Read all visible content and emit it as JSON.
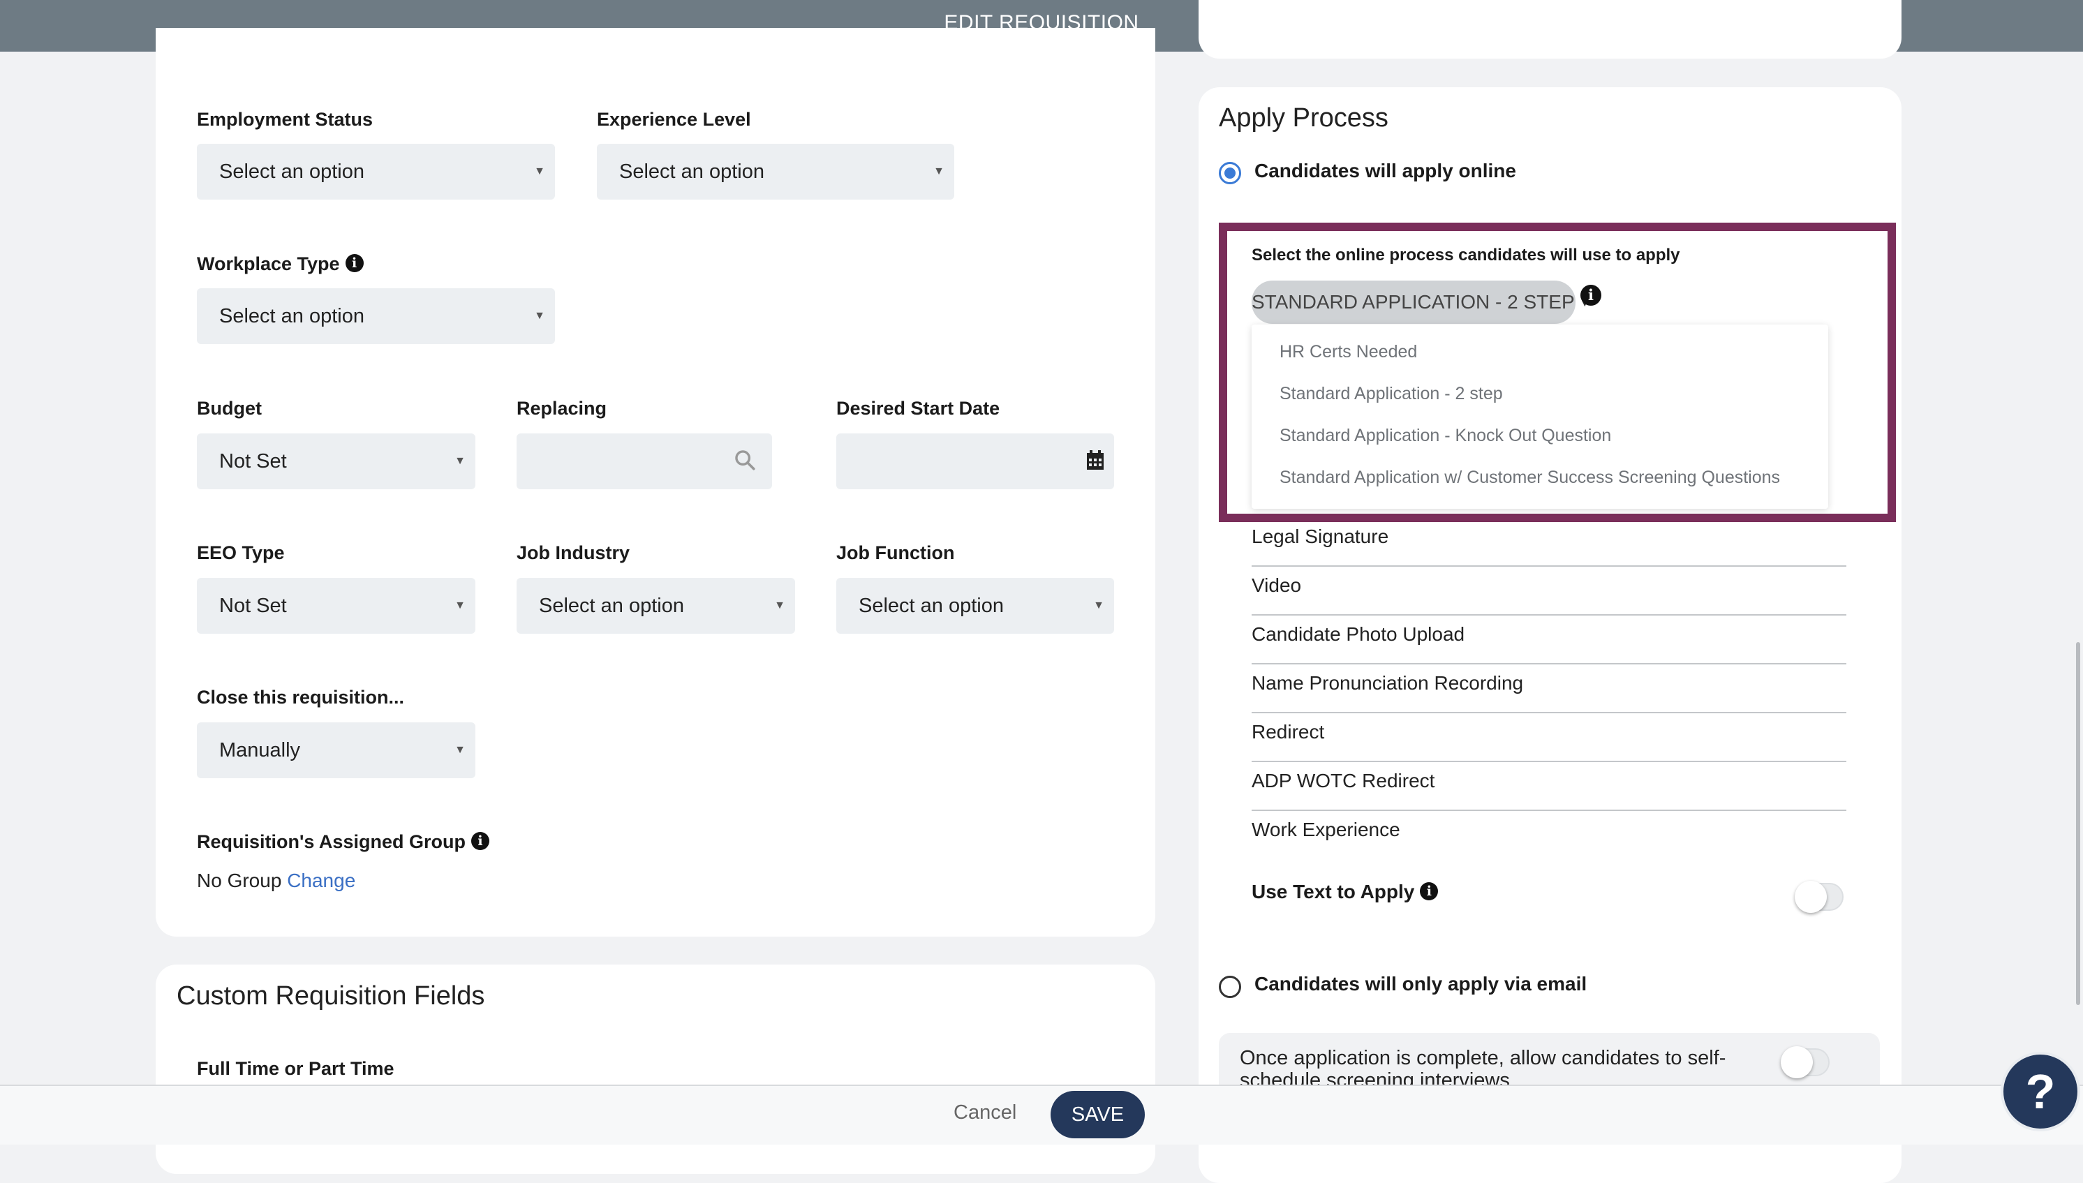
{
  "header": {
    "title": "EDIT REQUISITION"
  },
  "form": {
    "employment_status": {
      "label": "Employment Status",
      "value": "Select an option"
    },
    "experience_level": {
      "label": "Experience Level",
      "value": "Select an option"
    },
    "workplace_type": {
      "label": "Workplace Type",
      "value": "Select an option"
    },
    "budget": {
      "label": "Budget",
      "value": "Not Set"
    },
    "replacing": {
      "label": "Replacing",
      "value": ""
    },
    "desired_start_date": {
      "label": "Desired Start Date",
      "value": ""
    },
    "eeo_type": {
      "label": "EEO Type",
      "value": "Not Set"
    },
    "job_industry": {
      "label": "Job Industry",
      "value": "Select an option"
    },
    "job_function": {
      "label": "Job Function",
      "value": "Select an option"
    },
    "close_requisition": {
      "label": "Close this requisition...",
      "value": "Manually"
    },
    "assigned_group": {
      "label": "Requisition's Assigned Group",
      "value": "No Group",
      "change_link": "Change"
    }
  },
  "custom_fields": {
    "title": "Custom Requisition Fields",
    "field1_label": "Full Time or Part Time"
  },
  "apply_process": {
    "title": "Apply Process",
    "online_option": "Candidates will apply online",
    "select_label": "Select the online process candidates will use to apply",
    "selected_process": "STANDARD APPLICATION - 2 STEP",
    "dropdown_options": [
      "HR Certs Needed",
      "Standard Application - 2 step",
      "Standard Application - Knock Out Question",
      "Standard Application w/ Customer Success Screening Questions"
    ],
    "items": [
      "Legal Signature",
      "Video",
      "Candidate Photo Upload",
      "Name Pronunciation Recording",
      "Redirect",
      "ADP WOTC Redirect",
      "Work Experience"
    ],
    "text_to_apply": "Use Text to Apply",
    "text_to_apply_on": false,
    "email_option": "Candidates will only apply via email",
    "self_schedule_text": "Once application is complete, allow candidates to self-schedule screening interviews",
    "self_schedule_on": false
  },
  "footer": {
    "cancel": "Cancel",
    "save": "SAVE"
  },
  "help": {
    "icon": "question-mark-icon",
    "label": "?"
  },
  "colors": {
    "topbar": "#6e7b84",
    "primary": "#24385b",
    "highlight": "#7a2e5a",
    "link": "#3a6fc4",
    "radio": "#3b7bd6"
  }
}
